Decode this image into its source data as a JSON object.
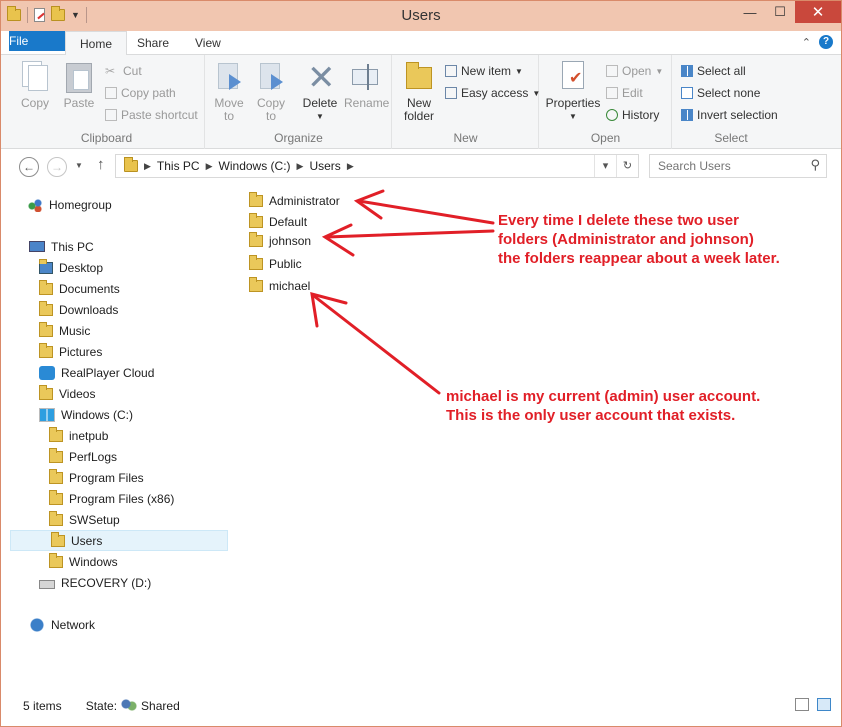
{
  "window": {
    "title": "Users"
  },
  "tabs": [
    "File",
    "Home",
    "Share",
    "View"
  ],
  "ribbon": {
    "clipboard": {
      "label": "Clipboard",
      "copy": "Copy",
      "paste": "Paste",
      "cut": "Cut",
      "copy_path": "Copy path",
      "paste_shortcut": "Paste shortcut"
    },
    "organize": {
      "label": "Organize",
      "move_to": "Move\nto",
      "copy_to": "Copy\nto",
      "delete": "Delete",
      "rename": "Rename"
    },
    "new": {
      "label": "New",
      "new_folder": "New\nfolder",
      "new_item": "New item",
      "easy_access": "Easy access"
    },
    "open": {
      "label": "Open",
      "properties": "Properties",
      "open": "Open",
      "edit": "Edit",
      "history": "History"
    },
    "select": {
      "label": "Select",
      "select_all": "Select all",
      "select_none": "Select none",
      "invert_selection": "Invert selection"
    }
  },
  "address": {
    "crumbs": [
      "This PC",
      "Windows (C:)",
      "Users"
    ]
  },
  "search": {
    "placeholder": "Search Users"
  },
  "nav": {
    "homegroup": "Homegroup",
    "this_pc": "This PC",
    "pc_items": [
      "Desktop",
      "Documents",
      "Downloads",
      "Music",
      "Pictures",
      "RealPlayer Cloud",
      "Videos",
      "Windows (C:)"
    ],
    "c_items": [
      "inetpub",
      "PerfLogs",
      "Program Files",
      "Program Files (x86)",
      "SWSetup",
      "Users",
      "Windows"
    ],
    "recovery": "RECOVERY (D:)",
    "network": "Network",
    "selected": "Users"
  },
  "files": [
    "Administrator",
    "Default",
    "johnson",
    "Public",
    "michael"
  ],
  "annotations": {
    "note1": [
      "Every time I delete these two user",
      "folders (Administrator and johnson)",
      "the folders reappear about a week later."
    ],
    "note2": [
      "michael is my current (admin) user account.",
      "This is the only user account that exists."
    ],
    "color": "#e11f27"
  },
  "status": {
    "count": "5 items",
    "state_label": "State:",
    "state_value": "Shared"
  }
}
